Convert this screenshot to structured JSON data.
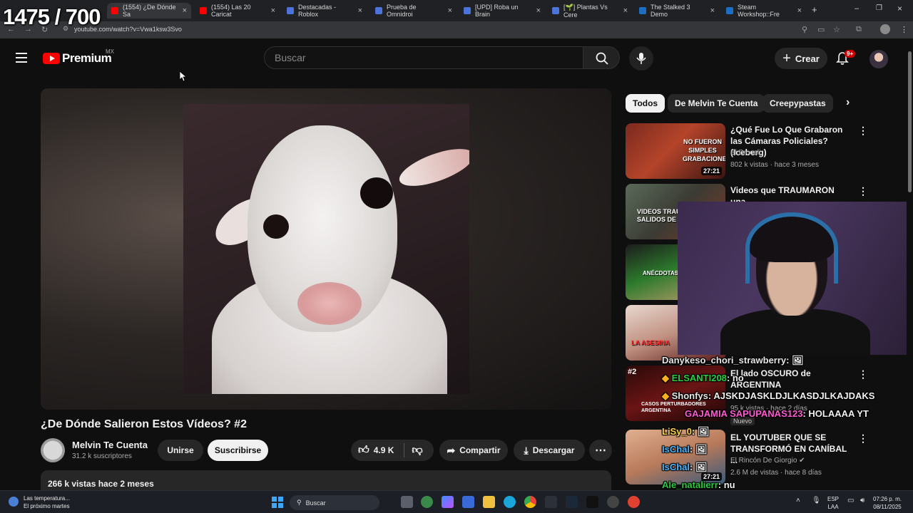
{
  "overlay": {
    "counter": "1475 / 700"
  },
  "browser": {
    "url": "youtube.com/watch?v=Vwa1ksw3Svo",
    "tabs": [
      {
        "label": "(1554) ¿De Dónde Sa",
        "color": "#ff0000"
      },
      {
        "label": "(1554) Las 20 Caricat",
        "color": "#ff0000"
      },
      {
        "label": "Destacadas - Roblox",
        "color": "#4a74d8"
      },
      {
        "label": "Prueba de Omnidroi",
        "color": "#4a74d8"
      },
      {
        "label": "[UPD] Roba un Brain",
        "color": "#4a74d8"
      },
      {
        "label": "[🌱] Plantas Vs Cere",
        "color": "#4a74d8"
      },
      {
        "label": "The Stalked 3 Demo",
        "color": "#1b6ec2"
      },
      {
        "label": "Steam Workshop::Fre",
        "color": "#1b6ec2"
      }
    ]
  },
  "header": {
    "logo_text": "Premium",
    "region": "MX",
    "search_placeholder": "Buscar",
    "create_label": "Crear",
    "notif_badge": "9+"
  },
  "video": {
    "title": "¿De Dónde Salieron Estos Vídeos? #2",
    "channel": "Melvin Te Cuenta",
    "subscribers": "31.2 k suscriptores",
    "join_label": "Unirse",
    "subscribe_label": "Suscribirse",
    "likes": "4.9 K",
    "share_label": "Compartir",
    "download_label": "Descargar",
    "views_date": "266 k vistas  hace 2 meses"
  },
  "chips": [
    "Todos",
    "De Melvin Te Cuenta",
    "Creepypastas"
  ],
  "recommendations": [
    {
      "title": "¿Qué Fue Lo Que Grabaron las Cámaras Policiales? (Iceberg)",
      "channel": "El Brocoli",
      "meta": "802 k vistas · hace 3 meses",
      "duration": "27:21",
      "thumb_text": "NO FUERON SIMPLES GRABACIONES"
    },
    {
      "title": "Videos que TRAUMARON una",
      "thumb_text": "VIDEOS TRAUMA SALIDOS DE F"
    },
    {
      "thumb_text": "ANÉCDOTAS DE"
    },
    {
      "thumb_text": "LA ASESINA"
    },
    {
      "title": "El lado OSCURO de ARGENTINA",
      "meta": "95 k vistas · hace 2 días",
      "thumb_text": "CASOS PERTURBADORES ARGENTINA",
      "rank": "#2",
      "new_label": "Nuevo"
    },
    {
      "title": "EL YOUTUBER QUE SE TRANSFORMÓ EN CANÍBAL ...",
      "channel": "El Rincón De Giorgio",
      "meta": "2.6 M de vistas · hace 8 días",
      "duration": "27:21"
    }
  ],
  "chat": [
    {
      "user": "Danykeso_chori_strawberry",
      "text": ": 🖼",
      "color": "#e6e6e6"
    },
    {
      "user": "ELSANTI208",
      "text": ": no",
      "color": "#2ecc40"
    },
    {
      "user": "Shonfys",
      "text": ": AJSKDJASKLDJLKASDJLKAJDAKS",
      "color": "#e6e6e6"
    },
    {
      "user": "GAJAMIA SAPUPANAS123",
      "text": ": HOLAAAA YT",
      "color": "#ff5bd1"
    },
    {
      "user": "LiSy_0",
      "text": ": 🖼",
      "color": "#ffd54a"
    },
    {
      "user": "IsChal",
      "text": ": 🖼",
      "color": "#4db8ff"
    },
    {
      "user": "IsChal",
      "text": ": 🖼",
      "color": "#4db8ff"
    },
    {
      "user": "Ale_natalierr",
      "text": ": nu",
      "color": "#2ecc40"
    }
  ],
  "taskbar": {
    "weather_line1": "Las temperatura...",
    "weather_line2": "El próximo martes",
    "search_label": "Buscar",
    "lang1": "ESP",
    "lang2": "LAA",
    "time": "07:26 p. m.",
    "date": "08/11/2025"
  }
}
